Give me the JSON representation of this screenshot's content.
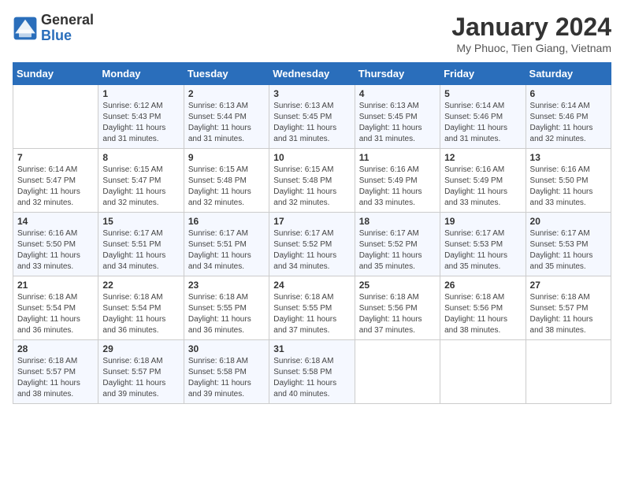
{
  "header": {
    "logo_general": "General",
    "logo_blue": "Blue",
    "month_title": "January 2024",
    "location": "My Phuoc, Tien Giang, Vietnam"
  },
  "days_of_week": [
    "Sunday",
    "Monday",
    "Tuesday",
    "Wednesday",
    "Thursday",
    "Friday",
    "Saturday"
  ],
  "weeks": [
    [
      {
        "day": "",
        "content": ""
      },
      {
        "day": "1",
        "content": "Sunrise: 6:12 AM\nSunset: 5:43 PM\nDaylight: 11 hours\nand 31 minutes."
      },
      {
        "day": "2",
        "content": "Sunrise: 6:13 AM\nSunset: 5:44 PM\nDaylight: 11 hours\nand 31 minutes."
      },
      {
        "day": "3",
        "content": "Sunrise: 6:13 AM\nSunset: 5:45 PM\nDaylight: 11 hours\nand 31 minutes."
      },
      {
        "day": "4",
        "content": "Sunrise: 6:13 AM\nSunset: 5:45 PM\nDaylight: 11 hours\nand 31 minutes."
      },
      {
        "day": "5",
        "content": "Sunrise: 6:14 AM\nSunset: 5:46 PM\nDaylight: 11 hours\nand 31 minutes."
      },
      {
        "day": "6",
        "content": "Sunrise: 6:14 AM\nSunset: 5:46 PM\nDaylight: 11 hours\nand 32 minutes."
      }
    ],
    [
      {
        "day": "7",
        "content": "Sunrise: 6:14 AM\nSunset: 5:47 PM\nDaylight: 11 hours\nand 32 minutes."
      },
      {
        "day": "8",
        "content": "Sunrise: 6:15 AM\nSunset: 5:47 PM\nDaylight: 11 hours\nand 32 minutes."
      },
      {
        "day": "9",
        "content": "Sunrise: 6:15 AM\nSunset: 5:48 PM\nDaylight: 11 hours\nand 32 minutes."
      },
      {
        "day": "10",
        "content": "Sunrise: 6:15 AM\nSunset: 5:48 PM\nDaylight: 11 hours\nand 32 minutes."
      },
      {
        "day": "11",
        "content": "Sunrise: 6:16 AM\nSunset: 5:49 PM\nDaylight: 11 hours\nand 33 minutes."
      },
      {
        "day": "12",
        "content": "Sunrise: 6:16 AM\nSunset: 5:49 PM\nDaylight: 11 hours\nand 33 minutes."
      },
      {
        "day": "13",
        "content": "Sunrise: 6:16 AM\nSunset: 5:50 PM\nDaylight: 11 hours\nand 33 minutes."
      }
    ],
    [
      {
        "day": "14",
        "content": "Sunrise: 6:16 AM\nSunset: 5:50 PM\nDaylight: 11 hours\nand 33 minutes."
      },
      {
        "day": "15",
        "content": "Sunrise: 6:17 AM\nSunset: 5:51 PM\nDaylight: 11 hours\nand 34 minutes."
      },
      {
        "day": "16",
        "content": "Sunrise: 6:17 AM\nSunset: 5:51 PM\nDaylight: 11 hours\nand 34 minutes."
      },
      {
        "day": "17",
        "content": "Sunrise: 6:17 AM\nSunset: 5:52 PM\nDaylight: 11 hours\nand 34 minutes."
      },
      {
        "day": "18",
        "content": "Sunrise: 6:17 AM\nSunset: 5:52 PM\nDaylight: 11 hours\nand 35 minutes."
      },
      {
        "day": "19",
        "content": "Sunrise: 6:17 AM\nSunset: 5:53 PM\nDaylight: 11 hours\nand 35 minutes."
      },
      {
        "day": "20",
        "content": "Sunrise: 6:17 AM\nSunset: 5:53 PM\nDaylight: 11 hours\nand 35 minutes."
      }
    ],
    [
      {
        "day": "21",
        "content": "Sunrise: 6:18 AM\nSunset: 5:54 PM\nDaylight: 11 hours\nand 36 minutes."
      },
      {
        "day": "22",
        "content": "Sunrise: 6:18 AM\nSunset: 5:54 PM\nDaylight: 11 hours\nand 36 minutes."
      },
      {
        "day": "23",
        "content": "Sunrise: 6:18 AM\nSunset: 5:55 PM\nDaylight: 11 hours\nand 36 minutes."
      },
      {
        "day": "24",
        "content": "Sunrise: 6:18 AM\nSunset: 5:55 PM\nDaylight: 11 hours\nand 37 minutes."
      },
      {
        "day": "25",
        "content": "Sunrise: 6:18 AM\nSunset: 5:56 PM\nDaylight: 11 hours\nand 37 minutes."
      },
      {
        "day": "26",
        "content": "Sunrise: 6:18 AM\nSunset: 5:56 PM\nDaylight: 11 hours\nand 38 minutes."
      },
      {
        "day": "27",
        "content": "Sunrise: 6:18 AM\nSunset: 5:57 PM\nDaylight: 11 hours\nand 38 minutes."
      }
    ],
    [
      {
        "day": "28",
        "content": "Sunrise: 6:18 AM\nSunset: 5:57 PM\nDaylight: 11 hours\nand 38 minutes."
      },
      {
        "day": "29",
        "content": "Sunrise: 6:18 AM\nSunset: 5:57 PM\nDaylight: 11 hours\nand 39 minutes."
      },
      {
        "day": "30",
        "content": "Sunrise: 6:18 AM\nSunset: 5:58 PM\nDaylight: 11 hours\nand 39 minutes."
      },
      {
        "day": "31",
        "content": "Sunrise: 6:18 AM\nSunset: 5:58 PM\nDaylight: 11 hours\nand 40 minutes."
      },
      {
        "day": "",
        "content": ""
      },
      {
        "day": "",
        "content": ""
      },
      {
        "day": "",
        "content": ""
      }
    ]
  ]
}
